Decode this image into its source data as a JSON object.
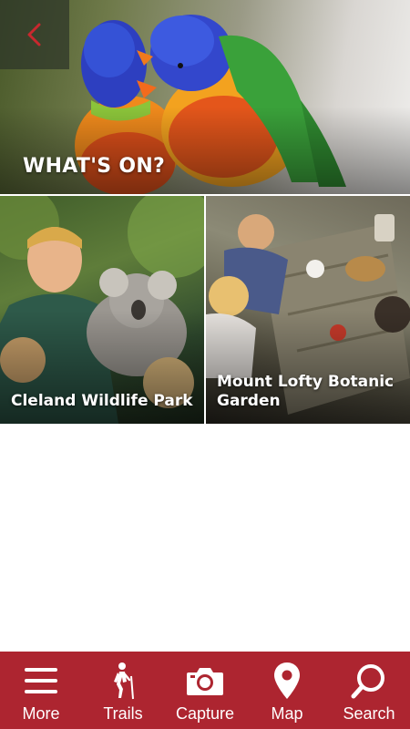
{
  "header": {
    "back_icon": "chevron-left-icon",
    "title": "WHAT'S ON?"
  },
  "tiles": [
    {
      "label": "Cleland Wildlife Park"
    },
    {
      "label": "Mount Lofty Botanic Garden"
    }
  ],
  "bottom_nav": {
    "items": [
      {
        "label": "More",
        "icon": "hamburger-menu-icon"
      },
      {
        "label": "Trails",
        "icon": "hiker-icon"
      },
      {
        "label": "Capture",
        "icon": "camera-icon"
      },
      {
        "label": "Map",
        "icon": "map-pin-icon"
      },
      {
        "label": "Search",
        "icon": "search-icon"
      }
    ]
  },
  "colors": {
    "brand_red": "#ad2530",
    "back_chevron": "#c8282e",
    "text_white": "#ffffff"
  }
}
